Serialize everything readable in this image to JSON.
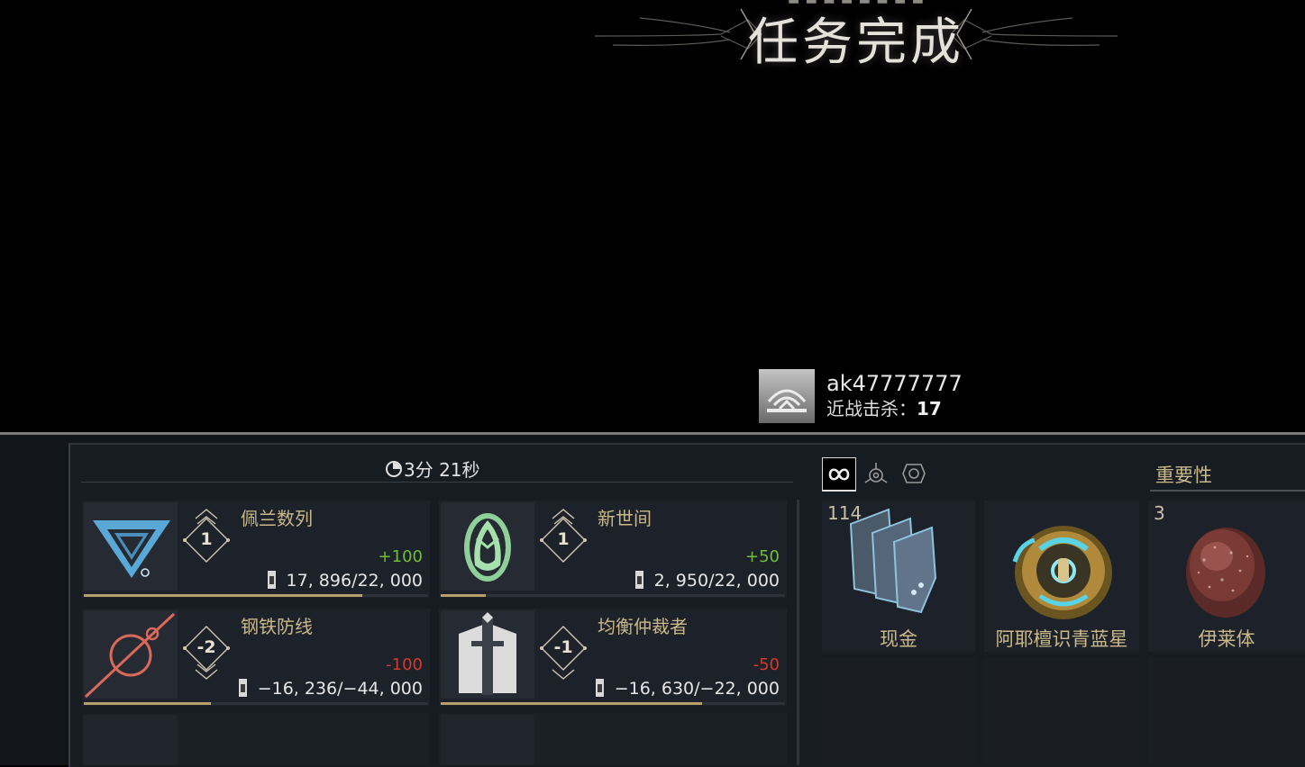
{
  "banner": {
    "subtitle": "■ ■ ■ ■ ■ ■ ■ ■",
    "title": "任务完成"
  },
  "player": {
    "name": "ak47777777",
    "kills_label": "近战击杀：",
    "kills_value": "17",
    "avatar_icon": "warframe-logo-icon"
  },
  "mission": {
    "duration": "3分 21秒"
  },
  "factions": [
    {
      "name": "佩兰数列",
      "rank": "1",
      "delta": "+100",
      "delta_type": "positive",
      "standing": "17, 896/22, 000",
      "progress": 0.81,
      "icon": "perrin-sequence-icon"
    },
    {
      "name": "新世间",
      "rank": "1",
      "delta": "+50",
      "delta_type": "positive",
      "standing": "2, 950/22, 000",
      "progress": 0.13,
      "icon": "new-loka-icon"
    },
    {
      "name": "钢铁防线",
      "rank": "-2",
      "delta": "-100",
      "delta_type": "negative",
      "standing": "−16, 236/−44, 000",
      "progress": 0.37,
      "icon": "steel-meridian-icon"
    },
    {
      "name": "均衡仲裁者",
      "rank": "-1",
      "delta": "-50",
      "delta_type": "negative",
      "standing": "−16, 630/−22, 000",
      "progress": 0.76,
      "icon": "arbiters-of-hexis-icon"
    }
  ],
  "rewards": {
    "importance_label": "重要性",
    "tabs": [
      "all-rewards-tab",
      "resources-tab",
      "mods-tab"
    ],
    "items": [
      {
        "name": "现金",
        "count": "114",
        "icon": "credits-icon"
      },
      {
        "name": "阿耶檀识青蓝星",
        "count": "",
        "icon": "ayatan-cyan-star-icon"
      },
      {
        "name": "伊莱体",
        "count": "3",
        "icon": "argon-crystal-icon"
      }
    ]
  },
  "colors": {
    "positive": "#6fbf3a",
    "negative": "#d23a2a",
    "gold": "#c9b98a",
    "progress": "#b8a06a"
  }
}
